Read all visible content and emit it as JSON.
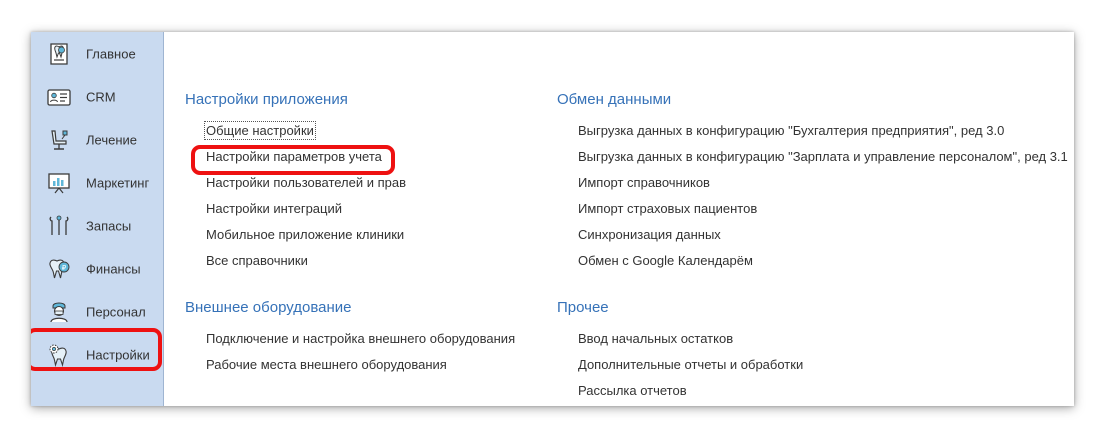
{
  "sidebar": {
    "items": [
      {
        "label": "Главное",
        "icon": "home-tooth-icon"
      },
      {
        "label": "CRM",
        "icon": "contact-card-icon"
      },
      {
        "label": "Лечение",
        "icon": "dental-chair-icon"
      },
      {
        "label": "Маркетинг",
        "icon": "presentation-chart-icon"
      },
      {
        "label": "Запасы",
        "icon": "dental-tools-icon"
      },
      {
        "label": "Финансы",
        "icon": "tooth-coin-icon"
      },
      {
        "label": "Персонал",
        "icon": "doctor-icon"
      },
      {
        "label": "Настройки",
        "icon": "tooth-gear-icon"
      }
    ],
    "selected": "Настройки"
  },
  "sections": {
    "app_settings": {
      "title": "Настройки приложения",
      "links": [
        "Общие настройки",
        "Настройки параметров учета",
        "Настройки пользователей и прав",
        "Настройки интеграций",
        "Мобильное приложение клиники",
        "Все справочники"
      ]
    },
    "external_equipment": {
      "title": "Внешнее оборудование",
      "links": [
        "Подключение и настройка внешнего оборудования",
        "Рабочие места внешнего оборудования"
      ]
    },
    "data_exchange": {
      "title": "Обмен данными",
      "links": [
        "Выгрузка данных в конфигурацию \"Бухгалтерия предприятия\", ред 3.0",
        "Выгрузка данных в конфигурацию \"Зарплата и управление персоналом\", ред 3.1",
        "Импорт справочников",
        "Импорт страховых пациентов",
        "Синхронизация данных",
        "Обмен с Google Календарём"
      ]
    },
    "other": {
      "title": "Прочее",
      "links": [
        "Ввод начальных остатков",
        "Дополнительные отчеты и обработки",
        "Рассылка отчетов"
      ]
    }
  },
  "colors": {
    "sidebar_bg": "#c9daf0",
    "section_title": "#3672b8",
    "highlight": "#ee1111",
    "text": "#333333"
  }
}
